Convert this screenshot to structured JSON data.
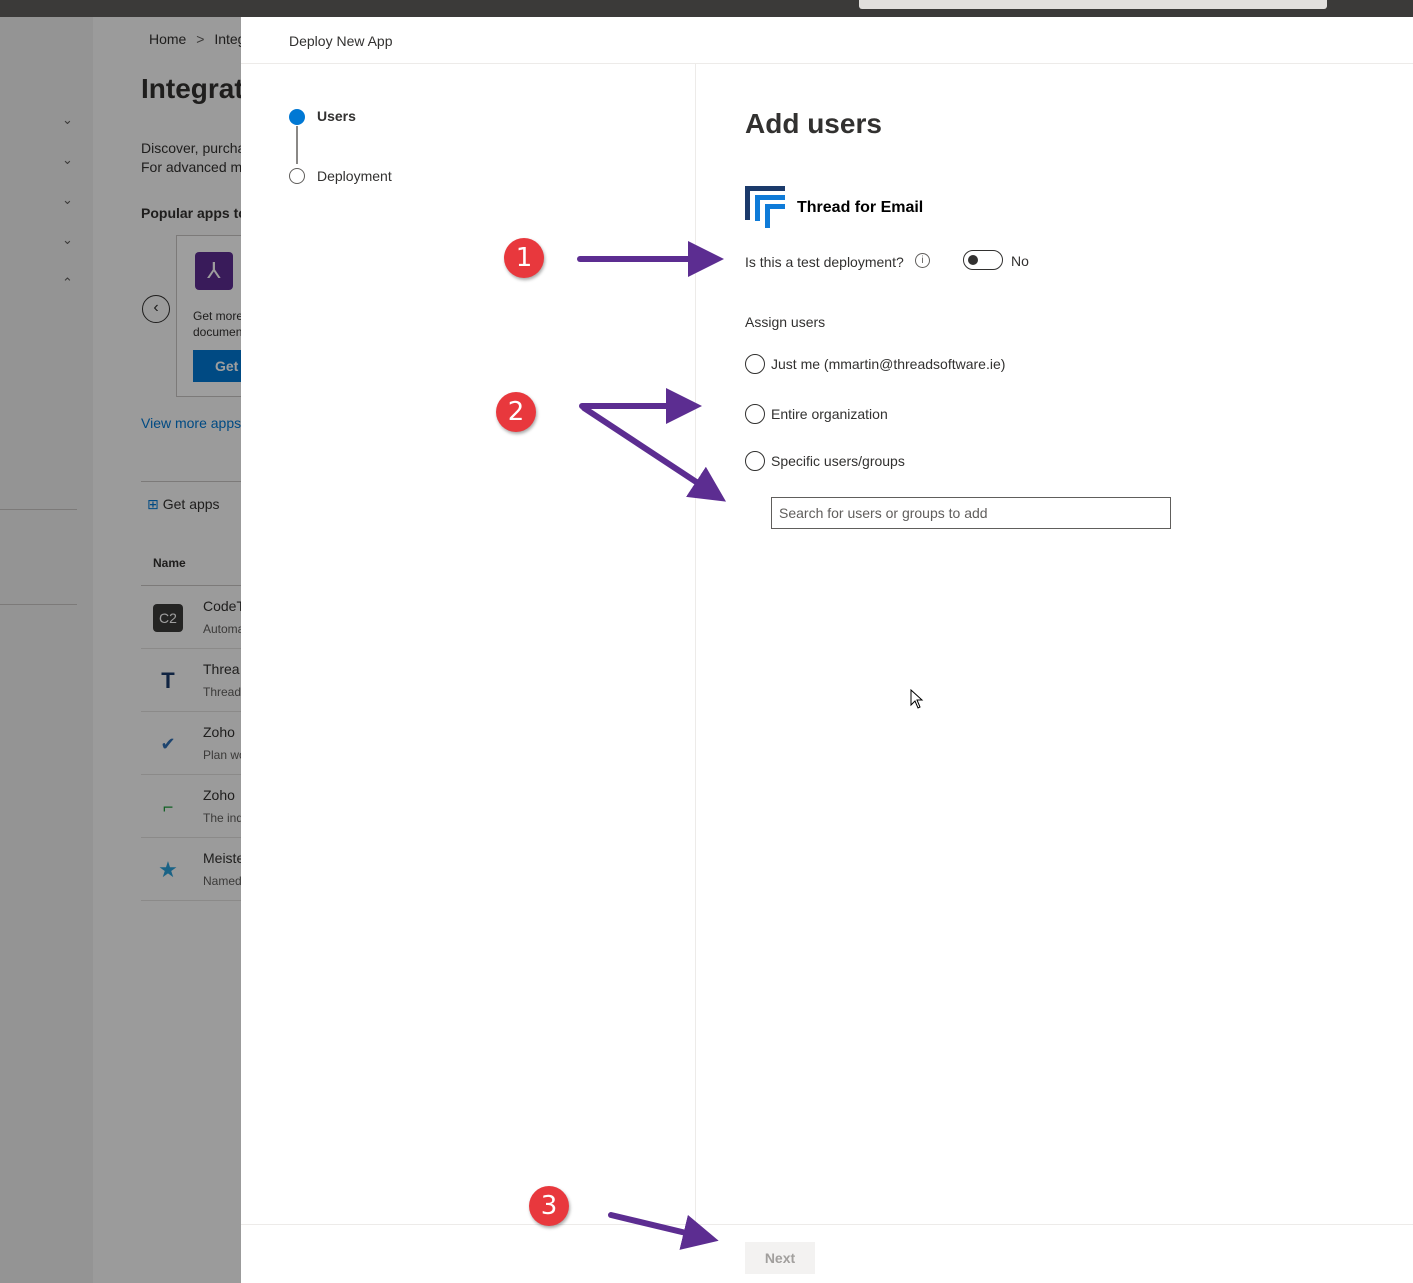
{
  "background": {
    "breadcrumb": [
      "Home",
      "Integ"
    ],
    "breadcrumb_sep": ">",
    "page_title": "Integrat",
    "description_line1": "Discover, purcha",
    "description_line2": "For advanced m",
    "popular_heading": "Popular apps to",
    "card": {
      "text_line1": "Get more",
      "text_line2": "documen",
      "button": "Get"
    },
    "view_more": "View more apps",
    "get_apps": "Get apps",
    "column_name": "Name",
    "rows": [
      {
        "name": "CodeT",
        "sub": "Automa",
        "icon": "C2"
      },
      {
        "name": "Threa",
        "sub": "Thread",
        "icon": "T"
      },
      {
        "name": "Zoho",
        "sub": "Plan wo",
        "icon": "✔"
      },
      {
        "name": "Zoho",
        "sub": "The ind",
        "icon": "⌐"
      },
      {
        "name": "Meiste",
        "sub": "Named",
        "icon": "★"
      }
    ]
  },
  "panel": {
    "title": "Deploy New App",
    "steps": [
      {
        "label": "Users",
        "state": "active"
      },
      {
        "label": "Deployment",
        "state": "pending"
      }
    ],
    "heading": "Add users",
    "app_name": "Thread for Email",
    "test_question": "Is this a test deployment?",
    "info_glyph": "i",
    "toggle_state": "No",
    "assign_label": "Assign users",
    "options": [
      {
        "label": "Just me (mmartin@threadsoftware.ie)"
      },
      {
        "label": "Entire organization"
      },
      {
        "label": "Specific users/groups"
      }
    ],
    "search_placeholder": "Search for users or groups to add",
    "next_button": "Next"
  },
  "annotations": {
    "badges": [
      "1",
      "2",
      "3"
    ],
    "color": "#5c2d91",
    "badge_color": "#e8383d"
  },
  "colors": {
    "accent": "#0078d4",
    "app_logo_dark": "#1b3a6b",
    "app_logo_light": "#0f7bd8"
  }
}
